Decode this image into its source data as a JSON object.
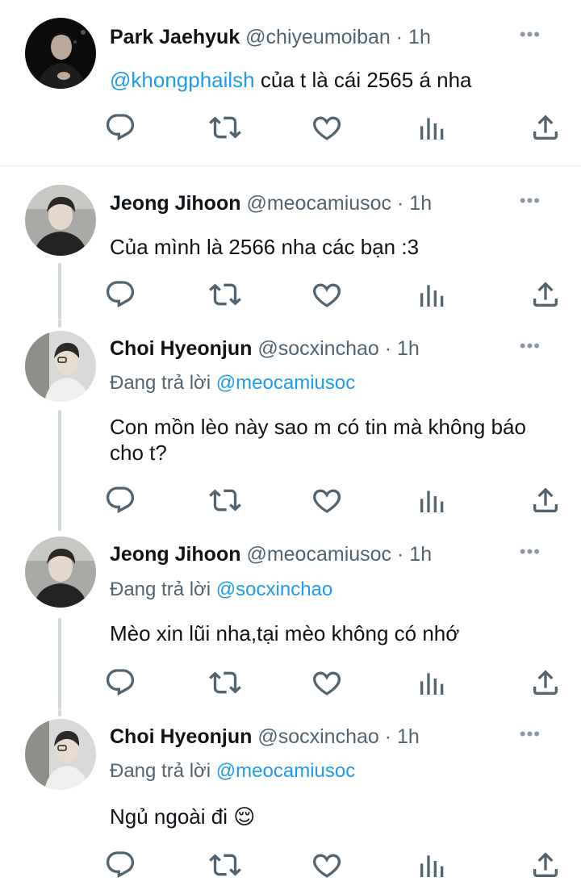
{
  "tweets": [
    {
      "name": "Park Jaehyuk",
      "handle": "@chiyeumoiban",
      "time": "· 1h",
      "reply_to_label": "",
      "reply_to_handle": "",
      "mention": "@khongphailsh",
      "text": "của t là cái 2565 á nha"
    },
    {
      "name": "Jeong Jihoon",
      "handle": "@meocamiusoc",
      "time": "· 1h",
      "text": "Của mình là 2566 nha các bạn :3"
    },
    {
      "name": "Choi Hyeonjun",
      "handle": "@socxinchao",
      "time": "· 1h",
      "reply_to_label": "Đang trả lời",
      "reply_to_handle": "@meocamiusoc",
      "text": "Con mồn lèo này sao m có tin mà không báo cho t?"
    },
    {
      "name": "Jeong Jihoon",
      "handle": "@meocamiusoc",
      "time": "· 1h",
      "reply_to_label": "Đang trả lời",
      "reply_to_handle": "@socxinchao",
      "text": "Mèo xin lũi nha,tại mèo không có nhớ"
    },
    {
      "name": "Choi Hyeonjun",
      "handle": "@socxinchao",
      "time": "· 1h",
      "reply_to_label": "Đang trả lời",
      "reply_to_handle": "@meocamiusoc",
      "text": "Ngủ ngoài đi 😌"
    }
  ],
  "icons": {
    "reply": "reply-icon",
    "retweet": "retweet-icon",
    "like": "like-icon",
    "analytics": "analytics-icon",
    "share": "share-icon",
    "more": "more-icon"
  },
  "colors": {
    "mention": "#1d9bf0",
    "secondary_text": "#536471",
    "icon": "#536471",
    "thread_line": "#cfd9de"
  }
}
